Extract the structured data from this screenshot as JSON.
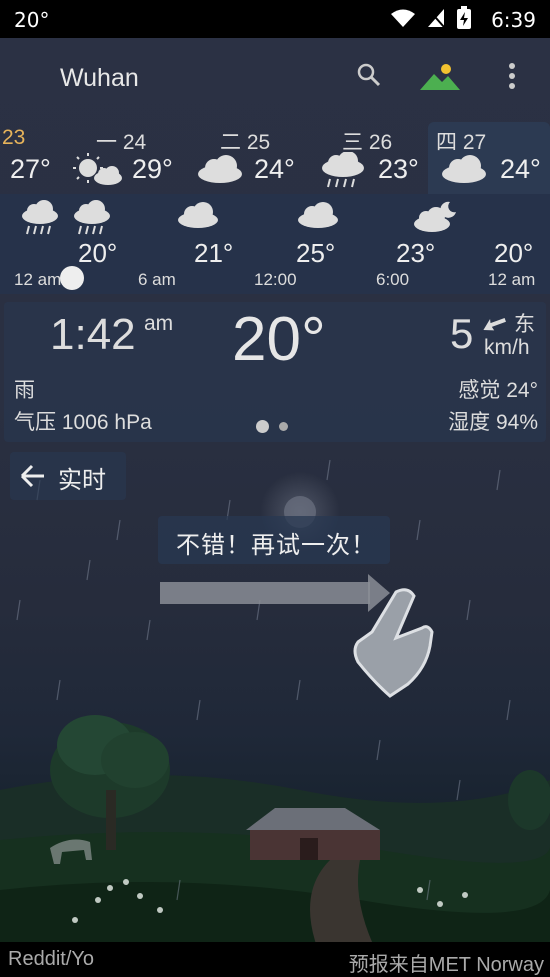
{
  "status_bar": {
    "temperature": "20°",
    "time": "6:39"
  },
  "app_bar": {
    "city": "Wuhan"
  },
  "days": [
    {
      "label": "23",
      "temp": "27°",
      "label_color": "#e6b35a"
    },
    {
      "label": "一 24",
      "temp": "29°",
      "icon": "sun-cloud-icon"
    },
    {
      "label": "二 25",
      "temp": "24°",
      "icon": "cloud-icon"
    },
    {
      "label": "三 26",
      "temp": "23°",
      "icon": "rain-cloud-icon"
    },
    {
      "label": "四 27",
      "temp": "24°",
      "icon": "cloud-icon"
    }
  ],
  "hourly": [
    {
      "temp": "20°",
      "label": "12 am"
    },
    {
      "temp": "21°",
      "label": "6 am"
    },
    {
      "temp": "25°",
      "label": "12:00"
    },
    {
      "temp": "23°",
      "label": "6:00"
    },
    {
      "temp": "20°",
      "label": "12 am"
    }
  ],
  "current": {
    "time": "1:42",
    "ampm": "am",
    "temperature": "20°",
    "wind_speed": "5",
    "wind_direction": "东",
    "wind_unit": "km/h",
    "condition": "雨",
    "pressure": "气压 1006 hPa",
    "feels_like": "感觉 24°",
    "humidity": "湿度 94%"
  },
  "realtime": {
    "label": "实时"
  },
  "tip": {
    "label": "不错！再试一次！"
  },
  "footer": {
    "credit_left": "Reddit/Yo",
    "credit_right": "预报来自MET Norway"
  },
  "colors": {
    "accent_green": "#4caf50",
    "accent_yellow": "#f2c230"
  }
}
